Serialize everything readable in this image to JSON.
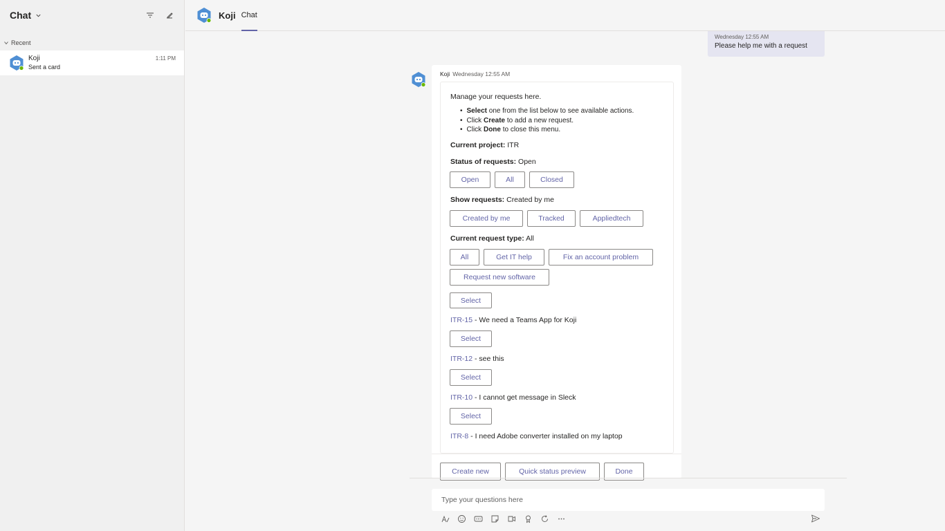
{
  "sidebar": {
    "title": "Chat",
    "section_label": "Recent",
    "items": [
      {
        "name": "Koji",
        "preview": "Sent a card",
        "time": "1:11 PM"
      }
    ]
  },
  "header": {
    "name": "Koji",
    "tab": "Chat"
  },
  "my_message": {
    "timestamp": "Wednesday 12:55 AM",
    "text": "Please help me with a request"
  },
  "bot_message": {
    "author": "Koji",
    "timestamp": "Wednesday 12:55 AM",
    "intro": "Manage your requests here.",
    "bullets": [
      {
        "bold": "Select",
        "rest": " one from the list below to see available actions.",
        "pre": ""
      },
      {
        "pre": "Click ",
        "bold": "Create",
        "rest": " to add a new request."
      },
      {
        "pre": "Click ",
        "bold": "Done",
        "rest": " to close this menu."
      }
    ],
    "project_label": "Current project:",
    "project_value": " ITR",
    "status_label": "Status of requests:",
    "status_value": " Open",
    "status_buttons": [
      "Open",
      "All",
      "Closed"
    ],
    "show_label": "Show requests:",
    "show_value": " Created by me",
    "show_buttons": [
      "Created by me",
      "Tracked",
      "Appliedtech"
    ],
    "type_label": "Current request type:",
    "type_value": " All",
    "type_buttons": [
      "All",
      "Get IT help",
      "Fix an account problem",
      "Request new software"
    ],
    "select_label": "Select",
    "requests": [
      {
        "key": "ITR-15",
        "title": " - We need a Teams App for Koji"
      },
      {
        "key": "ITR-12",
        "title": " - see this"
      },
      {
        "key": "ITR-10",
        "title": " - I cannot get message in Sleck"
      },
      {
        "key": "ITR-8",
        "title": " - I need Adobe converter installed on my laptop"
      }
    ],
    "footer_buttons": [
      "Create new",
      "Quick status preview",
      "Done"
    ]
  },
  "compose": {
    "placeholder": "Type your questions here"
  }
}
